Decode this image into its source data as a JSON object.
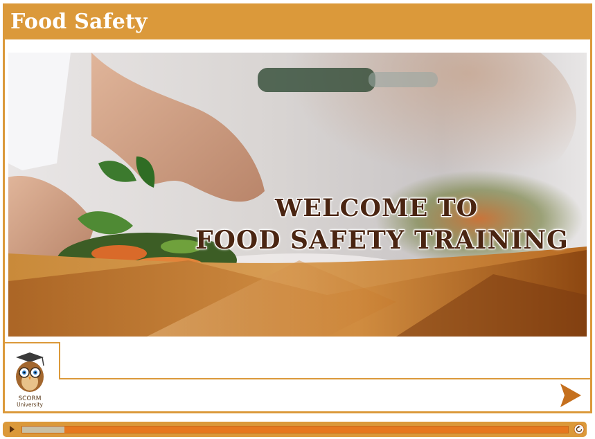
{
  "header": {
    "title": "Food Safety"
  },
  "hero": {
    "headline_line1": "WELCOME TO",
    "headline_line2": "FOOD SAFETY TRAINING",
    "image_description_icon": "chef-plating-salad-photo"
  },
  "logo": {
    "line1": "SCORM",
    "line2": "University",
    "icon": "owl-graduate-icon"
  },
  "navigation": {
    "next_icon": "next-arrow-icon"
  },
  "player": {
    "play_icon": "play-icon",
    "replay_icon": "replay-icon",
    "progress": 0.077
  },
  "colors": {
    "frame": "#db993a",
    "progress_track": "#e6781f",
    "progress_fill": "#c8c0a6",
    "headline": "#4a2512",
    "next_arrow": "#c5701e"
  }
}
